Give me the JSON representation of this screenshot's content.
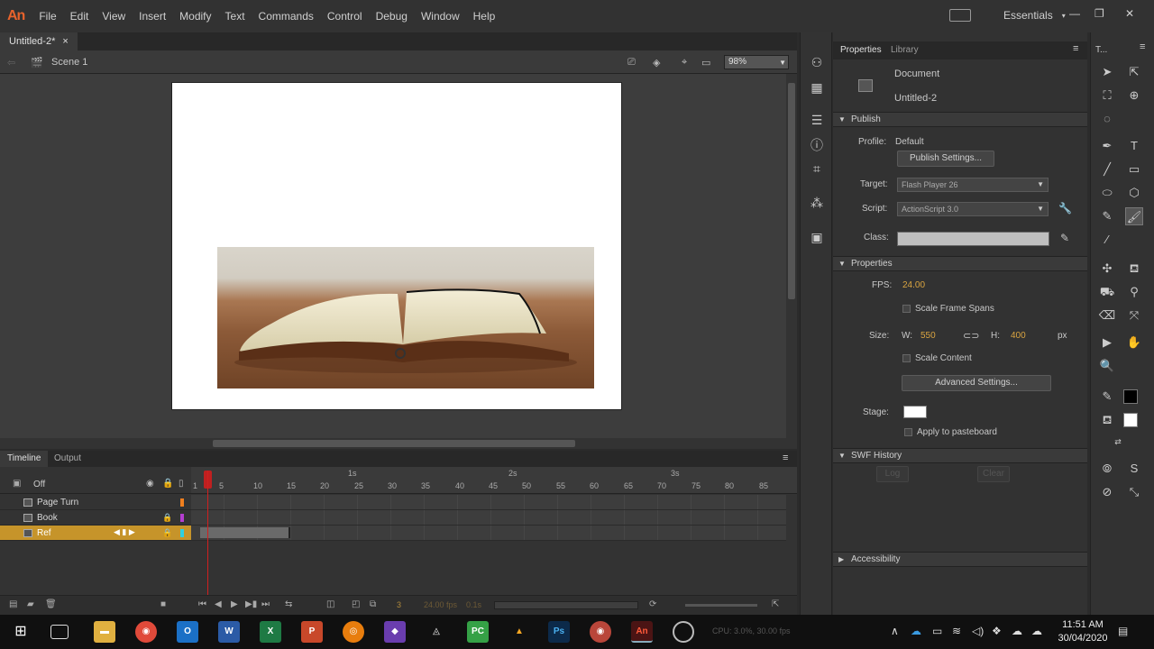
{
  "app": {
    "logo": "An"
  },
  "menu": [
    "File",
    "Edit",
    "View",
    "Insert",
    "Modify",
    "Text",
    "Commands",
    "Control",
    "Debug",
    "Window",
    "Help"
  ],
  "workspace": {
    "label": "Essentials"
  },
  "document": {
    "tab_title": "Untitled-2*",
    "close": "×",
    "scene": "Scene 1",
    "zoom": "98%"
  },
  "timeline": {
    "tabs": [
      "Timeline",
      "Output"
    ],
    "off_label": "Off",
    "layers": [
      {
        "name": "Page Turn",
        "color": "#f07f1e"
      },
      {
        "name": "Book",
        "color": "#b53ed1"
      },
      {
        "name": "Ref",
        "color": "#2fd0e0"
      }
    ],
    "seconds": [
      "1s",
      "2s",
      "3s"
    ],
    "frame_numbers": [
      "1",
      "5",
      "10",
      "15",
      "20",
      "25",
      "30",
      "35",
      "40",
      "45",
      "50",
      "55",
      "60",
      "65",
      "70",
      "75",
      "80",
      "85"
    ],
    "footer": {
      "frame": "3",
      "fps": "24.00 fps",
      "time": "0.1s"
    }
  },
  "properties": {
    "tabs": [
      "Properties",
      "Library"
    ],
    "doc_type": "Document",
    "doc_name": "Untitled-2",
    "publish": {
      "header": "Publish",
      "profile_label": "Profile:",
      "profile_value": "Default",
      "settings_btn": "Publish Settings...",
      "target_label": "Target:",
      "target_value": "Flash Player 26",
      "script_label": "Script:",
      "script_value": "ActionScript 3.0",
      "class_label": "Class:"
    },
    "props": {
      "header": "Properties",
      "fps_label": "FPS:",
      "fps_value": "24.00",
      "scale_spans": "Scale Frame Spans",
      "size_label": "Size:",
      "w_label": "W:",
      "w_value": "550",
      "h_label": "H:",
      "h_value": "400",
      "unit": "px",
      "scale_content": "Scale Content",
      "advanced_btn": "Advanced Settings...",
      "stage_label": "Stage:",
      "stage_color": "#ffffff",
      "apply_pasteboard": "Apply to pasteboard"
    },
    "swf_history": {
      "header": "SWF History",
      "log_btn": "Log",
      "clear_btn": "Clear"
    },
    "accessibility": {
      "header": "Accessibility"
    }
  },
  "tools_header": "T...",
  "taskbar": {
    "time": "11:51 AM",
    "date": "30/04/2020",
    "faded_status": "CPU: 3.0%, 30.00 fps"
  }
}
